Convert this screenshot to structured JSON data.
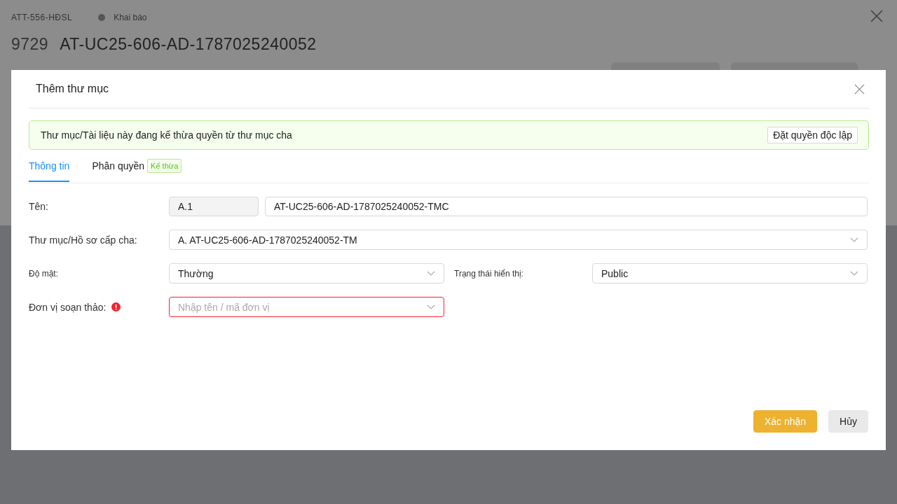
{
  "background": {
    "code": "ATT-556-HĐSL",
    "status": "Khai báo",
    "number": "9729",
    "title": "AT-UC25-606-AD-1787025240052"
  },
  "dialog": {
    "title": "Thêm thư mục",
    "notice": {
      "text": "Thư mục/Tài liệu này đang kế thừa quyền từ thư mục cha",
      "button": "Đặt quyền độc lập"
    },
    "tabs": [
      {
        "label": "Thông tin",
        "selected": true
      },
      {
        "label": "Phân quyền",
        "selected": false,
        "badge": "Kế thừa"
      }
    ],
    "rows": [
      {
        "fields": [
          {
            "kind": "text",
            "label": "Tên:",
            "prefix": "A.1",
            "value": "AT-UC25-606-AD-1787025240052-TMC",
            "required": false
          }
        ]
      },
      {
        "fields": [
          {
            "kind": "select",
            "label": "Thư mục/Hồ sơ cấp cha:",
            "value": "A. AT-UC25-606-AD-1787025240052-TM",
            "required": false
          }
        ]
      },
      {
        "fields": [
          {
            "kind": "select",
            "label": "Độ mật:",
            "value": "Thường",
            "required": false
          },
          {
            "kind": "select",
            "label": "Trạng thái hiển thị:",
            "value": "Public",
            "required": false
          }
        ]
      },
      {
        "fields": [
          {
            "kind": "select",
            "label": "Đơn vị soạn thảo:",
            "placeholder": "Nhập tên / mã đơn vị",
            "required": true
          }
        ]
      }
    ],
    "buttons": [
      {
        "label": "Xác nhận",
        "kind": "primary"
      },
      {
        "label": "Hủy",
        "kind": "default"
      }
    ]
  }
}
